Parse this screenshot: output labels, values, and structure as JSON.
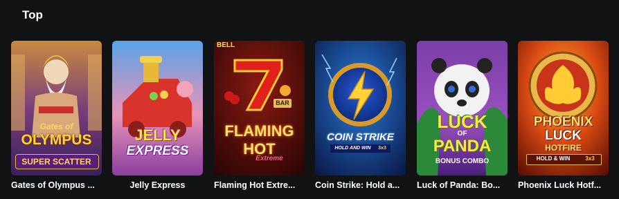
{
  "section": {
    "title": "Top"
  },
  "games": [
    {
      "title": "Gates of Olympus ...",
      "art_lines": [
        "Gates of",
        "OLYMPUS",
        "SUPER SCATTER"
      ]
    },
    {
      "title": "Jelly Express",
      "art_lines": [
        "JELLY",
        "EXPRESS"
      ]
    },
    {
      "title": "Flaming Hot Extre...",
      "art_lines": [
        "BELL",
        "BAR",
        "FLAMING",
        "HOT",
        "Extreme"
      ]
    },
    {
      "title": "Coin Strike: Hold a...",
      "art_lines": [
        "COIN STRIKE",
        "HOLD AND WIN",
        "3x3"
      ]
    },
    {
      "title": "Luck of Panda: Bo...",
      "art_lines": [
        "LUCK",
        "OF",
        "PANDA",
        "BONUS COMBO"
      ]
    },
    {
      "title": "Phoenix Luck Hotf...",
      "art_lines": [
        "PHOENIX",
        "LUCK",
        "HOTFIRE",
        "HOLD & WIN",
        "3x3"
      ]
    }
  ]
}
